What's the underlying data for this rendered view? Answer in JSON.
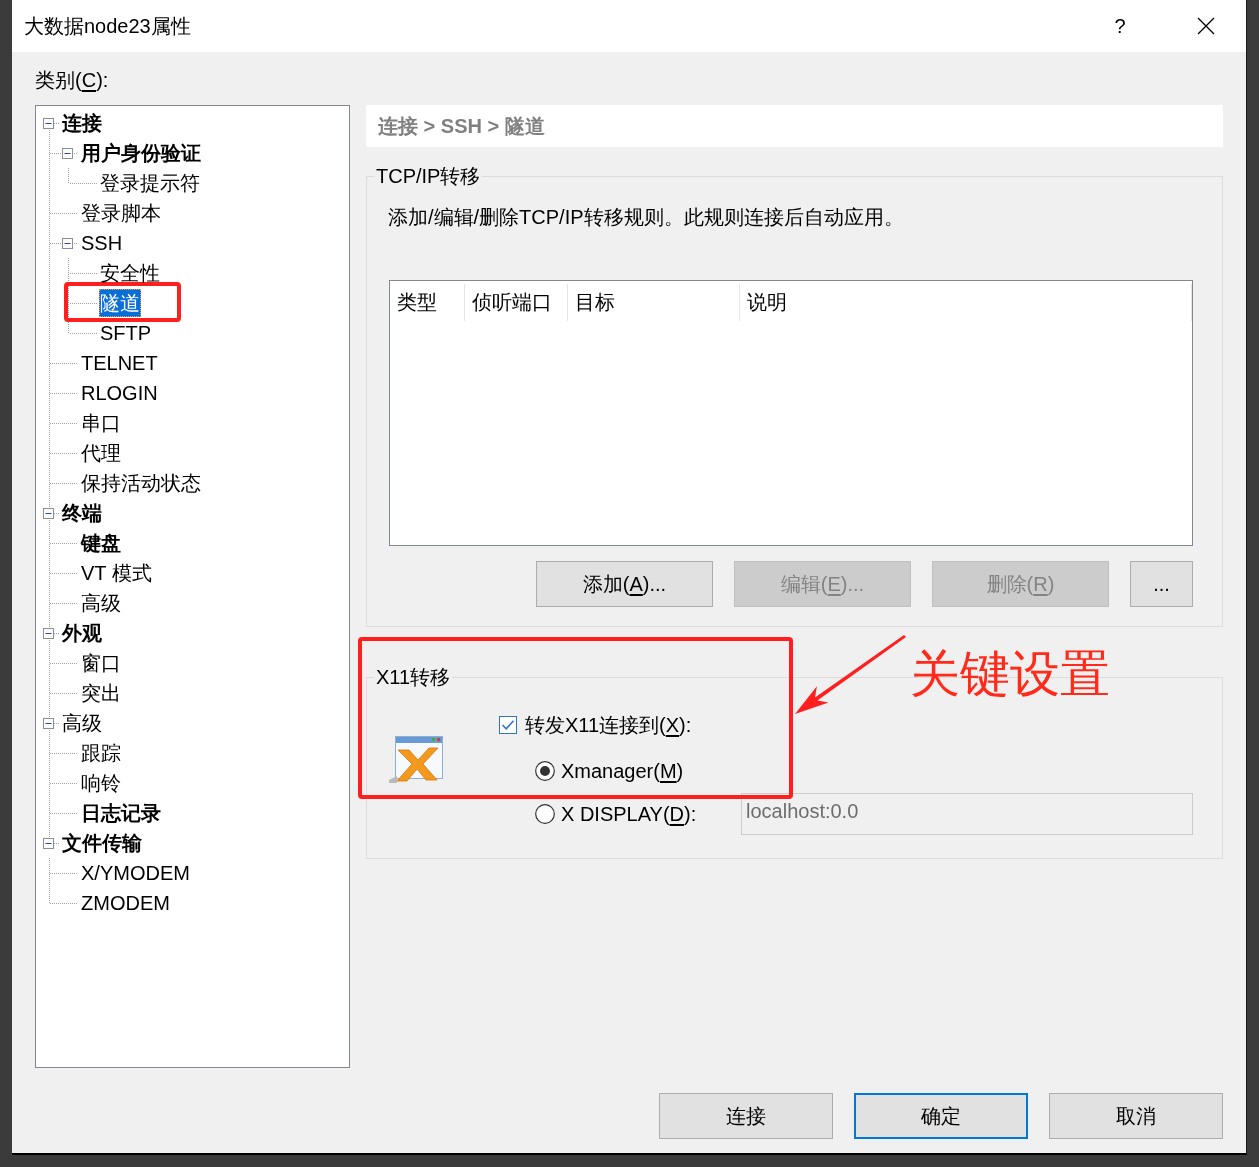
{
  "window": {
    "title": "大数据node23属性",
    "help_button": "?"
  },
  "category_label": [
    "类别(",
    "C",
    "):"
  ],
  "tree": {
    "items": [
      {
        "label": "连接",
        "bold": true,
        "selected": false,
        "expanded": true,
        "children": [
          {
            "label": "用户身份验证",
            "bold": true,
            "selected": false,
            "expanded": true,
            "children": [
              {
                "label": "登录提示符",
                "bold": false,
                "selected": false
              }
            ]
          },
          {
            "label": "登录脚本",
            "bold": false,
            "selected": false
          },
          {
            "label": "SSH",
            "bold": false,
            "selected": false,
            "expanded": true,
            "children": [
              {
                "label": "安全性",
                "bold": false,
                "selected": false
              },
              {
                "label": "隧道",
                "bold": false,
                "selected": true
              },
              {
                "label": "SFTP",
                "bold": false,
                "selected": false
              }
            ]
          },
          {
            "label": "TELNET",
            "bold": false,
            "selected": false
          },
          {
            "label": "RLOGIN",
            "bold": false,
            "selected": false
          },
          {
            "label": "串口",
            "bold": false,
            "selected": false
          },
          {
            "label": "代理",
            "bold": false,
            "selected": false
          },
          {
            "label": "保持活动状态",
            "bold": false,
            "selected": false
          }
        ]
      },
      {
        "label": "终端",
        "bold": true,
        "selected": false,
        "expanded": true,
        "children": [
          {
            "label": "键盘",
            "bold": true,
            "selected": false
          },
          {
            "label": "VT 模式",
            "bold": false,
            "selected": false
          },
          {
            "label": "高级",
            "bold": false,
            "selected": false
          }
        ]
      },
      {
        "label": "外观",
        "bold": true,
        "selected": false,
        "expanded": true,
        "children": [
          {
            "label": "窗口",
            "bold": false,
            "selected": false
          },
          {
            "label": "突出",
            "bold": false,
            "selected": false
          }
        ]
      },
      {
        "label": "高级",
        "bold": false,
        "selected": false,
        "expanded": true,
        "children": [
          {
            "label": "跟踪",
            "bold": false,
            "selected": false
          },
          {
            "label": "响铃",
            "bold": false,
            "selected": false
          },
          {
            "label": "日志记录",
            "bold": true,
            "selected": false
          }
        ]
      },
      {
        "label": "文件传输",
        "bold": true,
        "selected": false,
        "expanded": true,
        "children": [
          {
            "label": "X/YMODEM",
            "bold": false,
            "selected": false
          },
          {
            "label": "ZMODEM",
            "bold": false,
            "selected": false
          }
        ]
      }
    ]
  },
  "breadcrumb": "连接 > SSH > 隧道",
  "tcp_forwarding": {
    "title": "TCP/IP转移",
    "description": "添加/编辑/删除TCP/IP转移规则。此规则连接后自动应用。",
    "columns": [
      "类型",
      "侦听端口",
      "目标",
      "说明"
    ],
    "buttons": [
      {
        "label": [
          "添加(",
          "A",
          ")..."
        ],
        "disabled": false
      },
      {
        "label": [
          "编辑(",
          "E",
          ")..."
        ],
        "disabled": true
      },
      {
        "label": [
          "删除(",
          "R",
          ")"
        ],
        "disabled": true
      },
      {
        "label": [
          "..."
        ],
        "disabled": false
      }
    ]
  },
  "x11_forwarding": {
    "title": "X11转移",
    "forward": {
      "label": [
        "转发X11连接到(",
        "X",
        "):"
      ],
      "checked": true
    },
    "options": [
      {
        "label": [
          "Xmanager(",
          "M",
          ")"
        ],
        "selected": true
      },
      {
        "label": [
          "X DISPLAY(",
          "D",
          "):"
        ],
        "selected": false,
        "field": {
          "value": "localhost:0.0",
          "disabled": true
        }
      }
    ]
  },
  "annotation": {
    "text": "关键设置"
  },
  "footer_buttons": [
    {
      "label": "连接",
      "default": false
    },
    {
      "label": "确定",
      "default": true
    },
    {
      "label": "取消",
      "default": false
    }
  ]
}
